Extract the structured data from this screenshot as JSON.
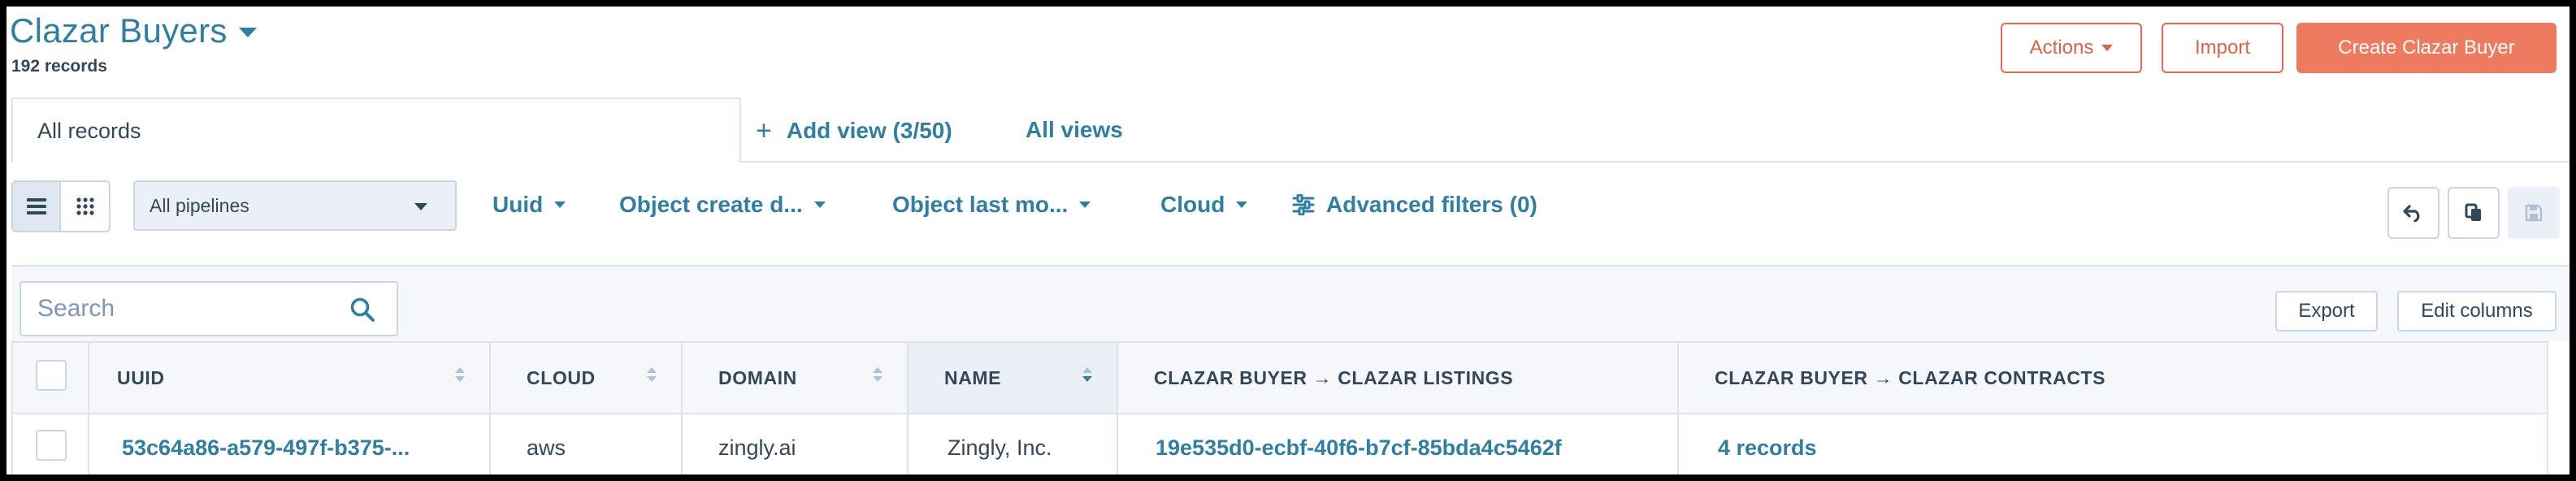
{
  "header": {
    "title": "Clazar Buyers",
    "record_count": "192 records",
    "actions_label": "Actions",
    "import_label": "Import",
    "create_label": "Create Clazar Buyer"
  },
  "tabs": {
    "active_label": "All records",
    "add_view_label": "Add view (3/50)",
    "all_views_label": "All views"
  },
  "filters": {
    "pipeline_value": "All pipelines",
    "items": [
      "Uuid",
      "Object create d...",
      "Object last mo...",
      "Cloud"
    ],
    "advanced_label": "Advanced filters (0)"
  },
  "toolbar": {
    "search_placeholder": "Search",
    "export_label": "Export",
    "edit_columns_label": "Edit columns"
  },
  "table": {
    "columns": [
      "UUID",
      "CLOUD",
      "DOMAIN",
      "NAME",
      "CLAZAR BUYER → CLAZAR LISTINGS",
      "CLAZAR BUYER → CLAZAR CONTRACTS"
    ],
    "rows": [
      {
        "uuid": "53c64a86-a579-497f-b375-...",
        "cloud": "aws",
        "domain": "zingly.ai",
        "name": "Zingly, Inc.",
        "listings": "19e535d0-ecbf-40f6-b7cf-85bda4c5462f",
        "contracts": "4 records"
      }
    ]
  },
  "colors": {
    "accent_link": "#2e7fa1",
    "primary_button": "#ee7a5f",
    "outline_button": "#ea6a50",
    "text": "#33475b",
    "border": "#cbd6e2"
  }
}
